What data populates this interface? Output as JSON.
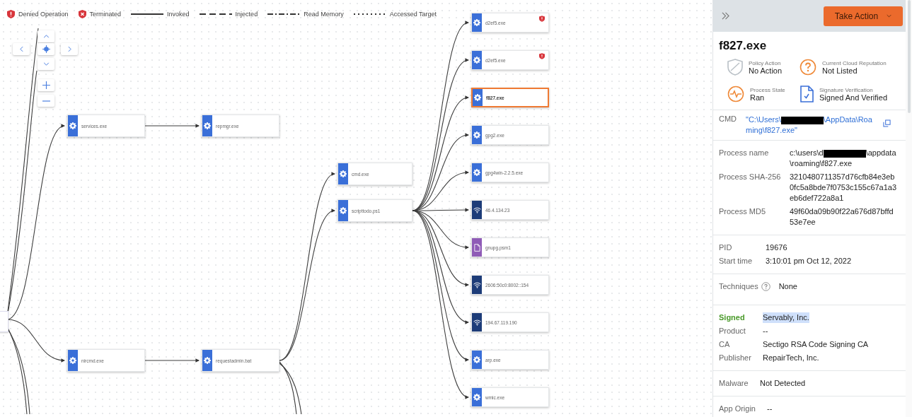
{
  "legend": [
    {
      "kind": "denied",
      "label": "Denied Operation"
    },
    {
      "kind": "terminated",
      "label": "Terminated"
    },
    {
      "kind": "invoked",
      "label": "Invoked"
    },
    {
      "kind": "injected",
      "label": "Injected"
    },
    {
      "kind": "read_memory",
      "label": "Read Memory"
    },
    {
      "kind": "accessed",
      "label": "Accessed Target"
    }
  ],
  "graph": {
    "nodes": [
      {
        "kind": "process",
        "label": "services.exe",
        "selected": false,
        "denied": false,
        "children": [
          {
            "kind": "process",
            "label": "repmgr.exe",
            "selected": false,
            "denied": false
          }
        ]
      },
      {
        "kind": "process",
        "label": "nircmd.exe",
        "selected": false,
        "denied": false,
        "children": [
          {
            "kind": "process",
            "label": "requestadmin.bat",
            "selected": false,
            "denied": false,
            "children": [
              {
                "kind": "process",
                "label": "cmd.exe",
                "selected": false,
                "denied": false
              },
              {
                "kind": "process",
                "label": "scripttodo.ps1",
                "selected": false,
                "denied": false,
                "children": [
                  {
                    "kind": "process",
                    "label": "d2ef5.exe",
                    "selected": false,
                    "denied": true
                  },
                  {
                    "kind": "process",
                    "label": "d2ef5.exe",
                    "selected": false,
                    "denied": true
                  },
                  {
                    "kind": "process",
                    "label": "f827.exe",
                    "selected": true,
                    "denied": false
                  },
                  {
                    "kind": "process",
                    "label": "gpg2.exe",
                    "selected": false,
                    "denied": false
                  },
                  {
                    "kind": "process",
                    "label": "gpg4win-2.2.5.exe",
                    "selected": false,
                    "denied": false
                  },
                  {
                    "kind": "network",
                    "label": "46.4.134.23",
                    "selected": false,
                    "denied": false
                  },
                  {
                    "kind": "file",
                    "label": "gnupg.psm1",
                    "selected": false,
                    "denied": false
                  },
                  {
                    "kind": "network",
                    "label": "2606:50c0:8002::154",
                    "selected": false,
                    "denied": false
                  },
                  {
                    "kind": "network",
                    "label": "194.67.119.190",
                    "selected": false,
                    "denied": false
                  },
                  {
                    "kind": "process",
                    "label": "arp.exe",
                    "selected": false,
                    "denied": false
                  },
                  {
                    "kind": "process",
                    "label": "wmic.exe",
                    "selected": false,
                    "denied": false
                  }
                ]
              }
            ]
          }
        ]
      }
    ]
  },
  "panel": {
    "action_button": "Take Action",
    "title": "f827.exe",
    "statuses": [
      {
        "kind": "policy",
        "label": "Policy Action",
        "value": "No Action"
      },
      {
        "kind": "reputation",
        "label": "Current Cloud Reputation",
        "value": "Not Listed"
      },
      {
        "kind": "state",
        "label": "Process State",
        "value": "Ran"
      },
      {
        "kind": "signature",
        "label": "Signature Verification",
        "value": "Signed And Verified"
      }
    ],
    "cmd": {
      "label": "CMD",
      "before": "\"C:\\Users\\",
      "after": "\\AppData\\Roaming\\f827.exe\""
    },
    "process": [
      {
        "label": "Process name",
        "before": "c:\\users\\d",
        "after": "\\appdata\\roaming\\f827.exe",
        "redacted": true
      },
      {
        "label": "Process SHA-256",
        "before": "3210480711357d76cfb84e3eb0fc5a8bde7f0753c155c67a1a3eb6def722a8a1",
        "redacted": false
      },
      {
        "label": "Process MD5",
        "before": "49f60da09b90f22a676d87bffd53e7ee",
        "redacted": false
      }
    ],
    "run": [
      {
        "label": "PID",
        "value": "19676"
      },
      {
        "label": "Start time",
        "value": "3:10:01 pm Oct 12, 2022"
      }
    ],
    "techniques": {
      "label": "Techniques",
      "value": "None"
    },
    "signer": [
      {
        "label": "Signed",
        "value": "Servably, Inc.",
        "kind": "status",
        "highlighted": true
      },
      {
        "label": "Product",
        "value": "--",
        "kind": "plain",
        "highlighted": false
      },
      {
        "label": "CA",
        "value": "Sectigo RSA Code Signing CA",
        "kind": "plain",
        "highlighted": false
      },
      {
        "label": "Publisher",
        "value": "RepairTech, Inc.",
        "kind": "plain",
        "highlighted": false
      }
    ],
    "malware": {
      "label": "Malware",
      "value": "Not Detected"
    },
    "origin": {
      "label": "App Origin",
      "value": "--"
    }
  }
}
